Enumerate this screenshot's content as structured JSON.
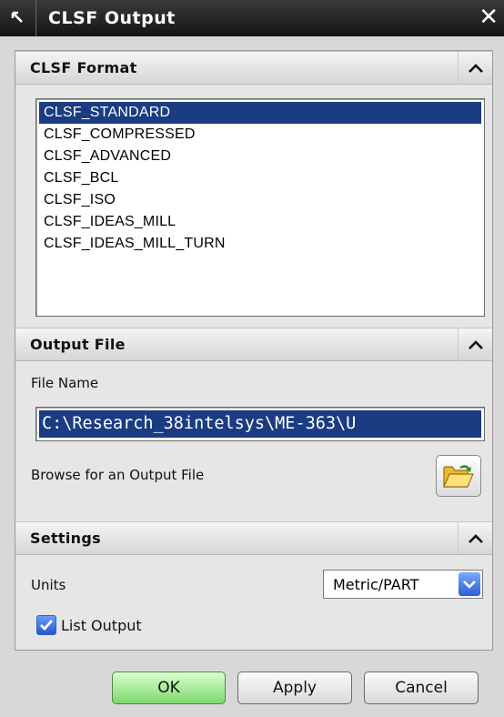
{
  "window": {
    "title": "CLSF Output"
  },
  "sections": {
    "format": {
      "label": "CLSF Format"
    },
    "output": {
      "label": "Output File"
    },
    "settings": {
      "label": "Settings"
    }
  },
  "format_list": {
    "items": [
      "CLSF_STANDARD",
      "CLSF_COMPRESSED",
      "CLSF_ADVANCED",
      "CLSF_BCL",
      "CLSF_ISO",
      "CLSF_IDEAS_MILL",
      "CLSF_IDEAS_MILL_TURN"
    ],
    "selected": "CLSF_STANDARD"
  },
  "output_file": {
    "file_name_label": "File Name",
    "file_name_value": "C:\\Research_38intelsys\\ME-363\\U",
    "browse_label": "Browse for an Output File"
  },
  "settings": {
    "units_label": "Units",
    "units_value": "Metric/PART",
    "list_output_label": "List Output",
    "list_output_checked": true
  },
  "buttons": {
    "ok": "OK",
    "apply": "Apply",
    "cancel": "Cancel"
  },
  "colors": {
    "selection": "#1b3b82",
    "ok_button": "#7ed96c",
    "accent": "#2a5fd6"
  },
  "icons": {
    "pin": "pin-icon",
    "close": "close-icon",
    "collapse": "chevron-up-icon",
    "browse": "folder-open-icon",
    "dropdown": "chevron-down-icon",
    "check": "checkmark-icon"
  }
}
